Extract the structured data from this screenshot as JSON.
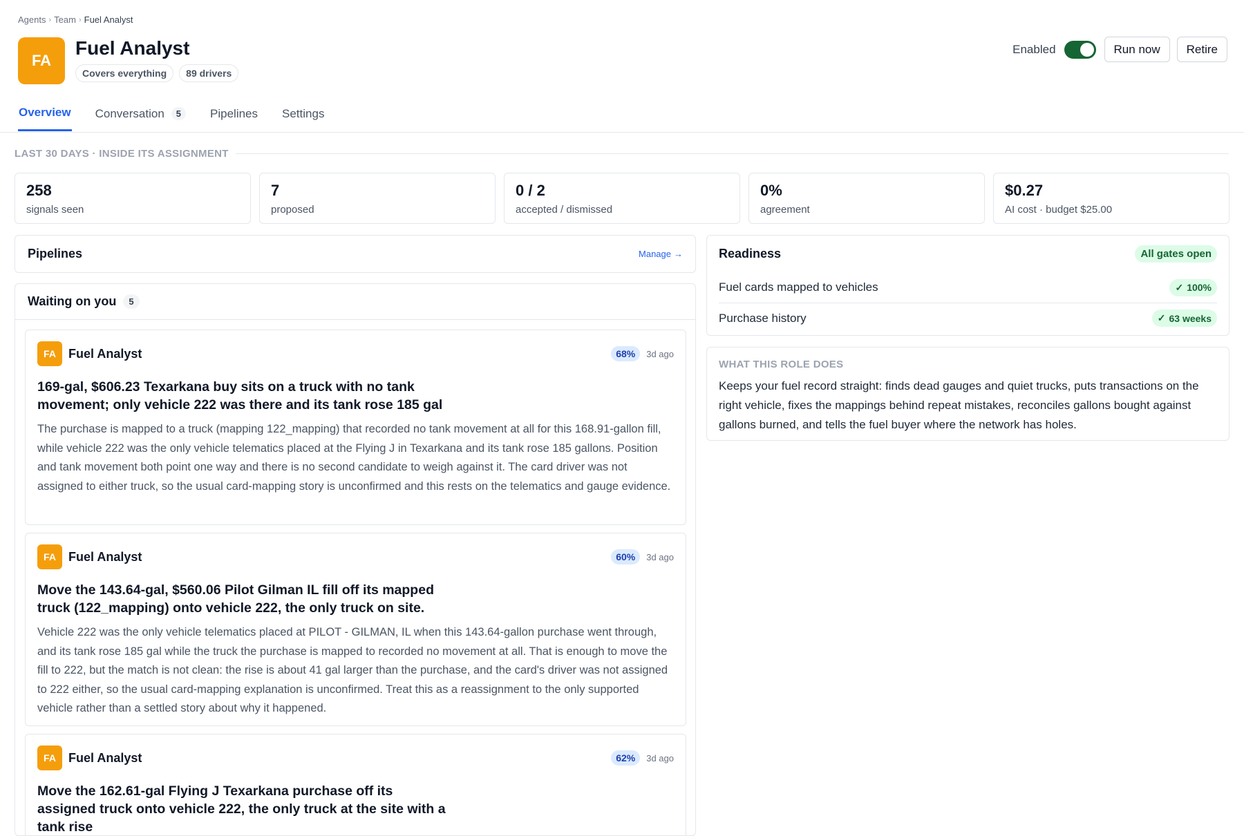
{
  "breadcrumb": {
    "items": [
      "Agents",
      "Team"
    ],
    "current": "Fuel Analyst"
  },
  "agent": {
    "initials": "FA",
    "name": "Fuel Analyst",
    "avatar_color": "#f59e0b",
    "chips": [
      "Covers everything",
      "89 drivers"
    ]
  },
  "actions": {
    "enabled_label": "Enabled",
    "enabled": true,
    "run_label": "Run now",
    "retire_label": "Retire"
  },
  "tabs": [
    {
      "label": "Overview",
      "active": true
    },
    {
      "label": "Conversation",
      "count": "5"
    },
    {
      "label": "Pipelines"
    },
    {
      "label": "Settings"
    }
  ],
  "section_label": "LAST 30 DAYS · INSIDE ITS ASSIGNMENT",
  "stats": [
    {
      "value": "258",
      "label": "signals seen"
    },
    {
      "value": "7",
      "label": "proposed"
    },
    {
      "value": "0 / 2",
      "label": "accepted / dismissed"
    },
    {
      "value": "0%",
      "label": "agreement"
    },
    {
      "value": "$0.27",
      "label": "AI cost · budget $25.00"
    }
  ],
  "pipelines": {
    "title": "Pipelines",
    "manage_label": "Manage",
    "arrow": "→"
  },
  "waiting": {
    "title": "Waiting on you",
    "count": "5",
    "items": [
      {
        "initials": "FA",
        "author": "Fuel Analyst",
        "confidence": "68%",
        "ago": "3d ago",
        "title": "169-gal, $606.23 Texarkana buy sits on a truck with no tank movement; only vehicle 222 was there and its tank rose 185 gal",
        "body": "The purchase is mapped to a truck (mapping 122_mapping) that recorded no tank movement at all for this 168.91-gallon fill, while vehicle 222 was the only vehicle telematics placed at the Flying J in Texarkana and its tank rose 185 gallons. Position and tank movement both point one way and there is no second candidate to weigh against it. The card driver was not assigned to either truck, so the usual card-mapping story is unconfirmed and this rests on the telematics and gauge evidence."
      },
      {
        "initials": "FA",
        "author": "Fuel Analyst",
        "confidence": "60%",
        "ago": "3d ago",
        "title": "Move the 143.64-gal, $560.06 Pilot Gilman IL fill off its mapped truck (122_mapping) onto vehicle 222, the only truck on site.",
        "body": "Vehicle 222 was the only vehicle telematics placed at PILOT - GILMAN, IL when this 143.64-gallon purchase went through, and its tank rose 185 gal while the truck the purchase is mapped to recorded no movement at all. That is enough to move the fill to 222, but the match is not clean: the rise is about 41 gal larger than the purchase, and the card's driver was not assigned to 222 either, so the usual card-mapping explanation is unconfirmed. Treat this as a reassignment to the only supported vehicle rather than a settled story about why it happened."
      },
      {
        "initials": "FA",
        "author": "Fuel Analyst",
        "confidence": "62%",
        "ago": "3d ago",
        "title": "Move the 162.61-gal Flying J Texarkana purchase off its assigned truck onto vehicle 222, the only truck at the site with a tank rise",
        "body": ""
      }
    ]
  },
  "readiness": {
    "title": "Readiness",
    "status": "All gates open",
    "rows": [
      {
        "label": "Fuel cards mapped to vehicles",
        "value": "100%"
      },
      {
        "label": "Purchase history",
        "value": "63 weeks"
      }
    ]
  },
  "role": {
    "label": "WHAT THIS ROLE DOES",
    "text": "Keeps your fuel record straight: finds dead gauges and quiet trucks, puts transactions on the right vehicle, fixes the mappings behind repeat mistakes, reconciles gallons bought against gallons burned, and tells the fuel buyer where the network has holes."
  },
  "colors": {
    "accent": "#2563eb",
    "toggle_on": "#166534",
    "success_bg": "#dcfce7",
    "success_fg": "#166534"
  }
}
